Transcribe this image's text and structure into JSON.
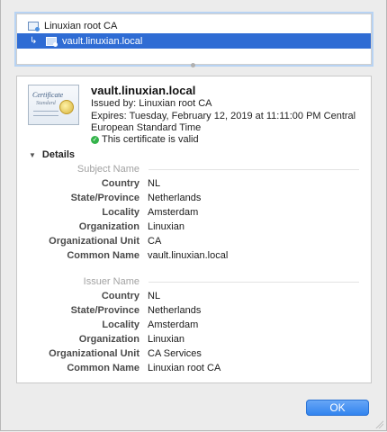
{
  "chain": {
    "root_label": "Linuxian root CA",
    "leaf_label": "vault.linuxian.local"
  },
  "certificate": {
    "name": "vault.linuxian.local",
    "issued_by": "Issued by: Linuxian root CA",
    "expires_line1": "Expires: Tuesday, February 12, 2019 at 11:11:00 PM Central",
    "expires_line2": "European Standard Time",
    "validity": "This certificate is valid",
    "badge_title": "Certificate",
    "badge_subtitle": "Standard"
  },
  "details": {
    "toggle_label": "Details",
    "subject": {
      "heading": "Subject Name",
      "fields": [
        {
          "label": "Country",
          "value": "NL"
        },
        {
          "label": "State/Province",
          "value": "Netherlands"
        },
        {
          "label": "Locality",
          "value": "Amsterdam"
        },
        {
          "label": "Organization",
          "value": "Linuxian"
        },
        {
          "label": "Organizational Unit",
          "value": "CA"
        },
        {
          "label": "Common Name",
          "value": "vault.linuxian.local"
        }
      ]
    },
    "issuer": {
      "heading": "Issuer Name",
      "fields": [
        {
          "label": "Country",
          "value": "NL"
        },
        {
          "label": "State/Province",
          "value": "Netherlands"
        },
        {
          "label": "Locality",
          "value": "Amsterdam"
        },
        {
          "label": "Organization",
          "value": "Linuxian"
        },
        {
          "label": "Organizational Unit",
          "value": "CA Services"
        },
        {
          "label": "Common Name",
          "value": "Linuxian root CA"
        }
      ]
    }
  },
  "footer": {
    "ok_label": "OK"
  },
  "colors": {
    "selection": "#2f6cd4",
    "button": "#2f82ee",
    "valid": "#33b34a"
  }
}
